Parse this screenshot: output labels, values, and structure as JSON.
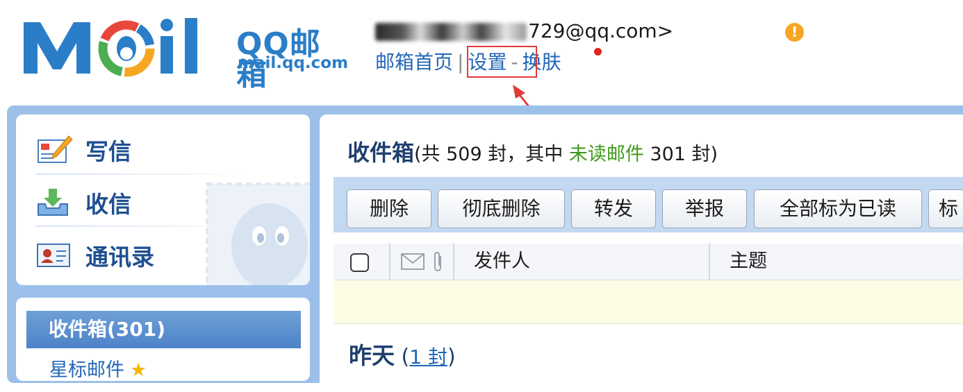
{
  "brand": {
    "logo_cn": "QQ邮箱",
    "logo_domain": "mail.qq.com",
    "colors": {
      "primary": "#2a7ec8",
      "logo_orange": "#f5a623",
      "logo_green": "#4cae4f",
      "logo_red": "#e8473c"
    }
  },
  "header": {
    "account_suffix": "729@qq.com>",
    "warning_icon": "exclamation-circle-icon",
    "nav": {
      "home": "邮箱首页",
      "sep1": "|",
      "settings": "设置",
      "sep2": "-",
      "skin": "换肤"
    }
  },
  "sidebar": {
    "actions": [
      {
        "label": "写信",
        "icon": "compose-icon"
      },
      {
        "label": "收信",
        "icon": "inbox-download-icon"
      },
      {
        "label": "通讯录",
        "icon": "contacts-card-icon"
      }
    ],
    "folders": {
      "active": "收件箱(301)",
      "starred": "星标邮件",
      "starred_icon": "star-icon"
    }
  },
  "main": {
    "title": "收件箱",
    "count_prefix": "(共 509 封，其中 ",
    "unread_label": "未读邮件",
    "count_suffix": " 301 封)",
    "toolbar": {
      "delete": "删除",
      "delete_forever": "彻底删除",
      "forward": "转发",
      "report": "举报",
      "mark_all_read": "全部标为已读",
      "mark_partial": "标"
    },
    "columns": {
      "sender": "发件人",
      "subject": "主题"
    },
    "group": {
      "date": "昨天",
      "count_open": "(",
      "count_link": "1 封",
      "count_close": ")"
    }
  }
}
